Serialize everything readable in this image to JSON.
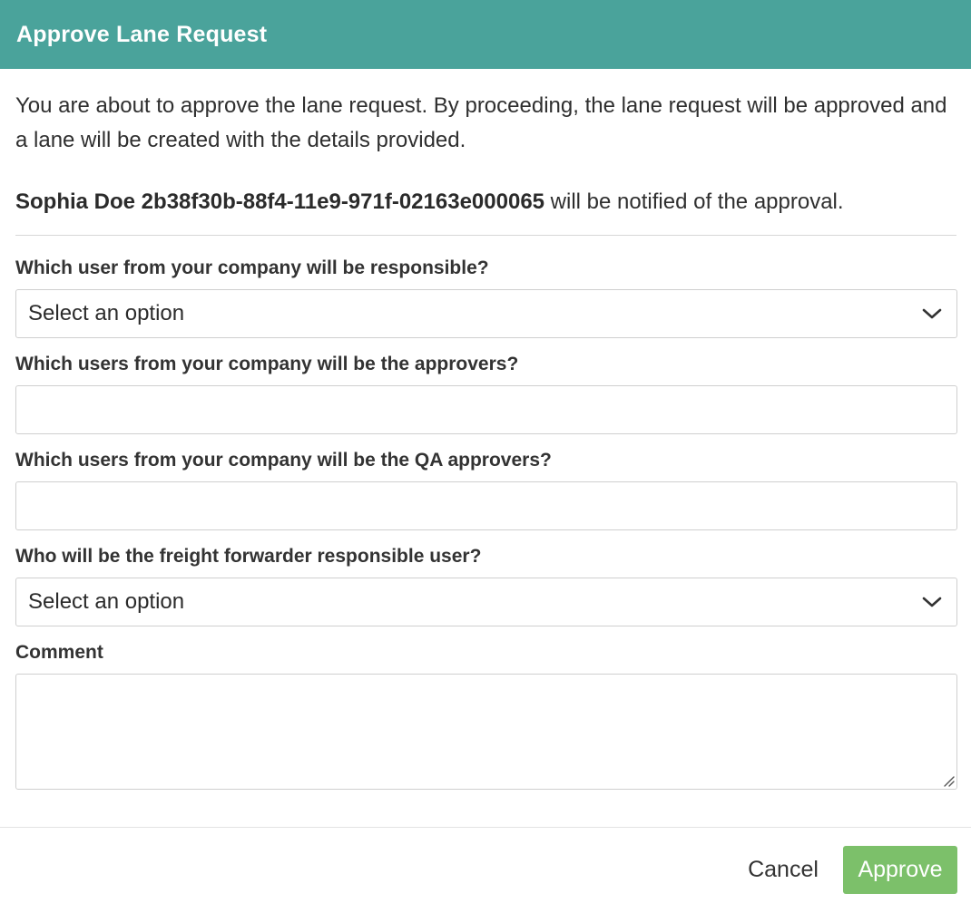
{
  "dialog": {
    "title": "Approve Lane Request",
    "intro": "You are about to approve the lane request. By proceeding, the lane request will be approved and a lane will be created with the details provided.",
    "notify_name": "Sophia Doe 2b38f30b-88f4-11e9-971f-02163e000065",
    "notify_suffix": " will be notified of the approval."
  },
  "form": {
    "responsible": {
      "label": "Which user from your company will be responsible?",
      "value": "Select an option"
    },
    "approvers": {
      "label": "Which users from your company will be the approvers?",
      "value": ""
    },
    "qa_approvers": {
      "label": "Which users from your company will be the QA approvers?",
      "value": ""
    },
    "forwarder": {
      "label": "Who will be the freight forwarder responsible user?",
      "value": "Select an option"
    },
    "comment": {
      "label": "Comment",
      "value": ""
    }
  },
  "footer": {
    "cancel_label": "Cancel",
    "approve_label": "Approve"
  },
  "colors": {
    "header": "#4aa39b",
    "approve": "#7cc06a"
  },
  "icons": {
    "select_arrow": "chevron-down-icon",
    "resize": "resize-grip-icon"
  }
}
